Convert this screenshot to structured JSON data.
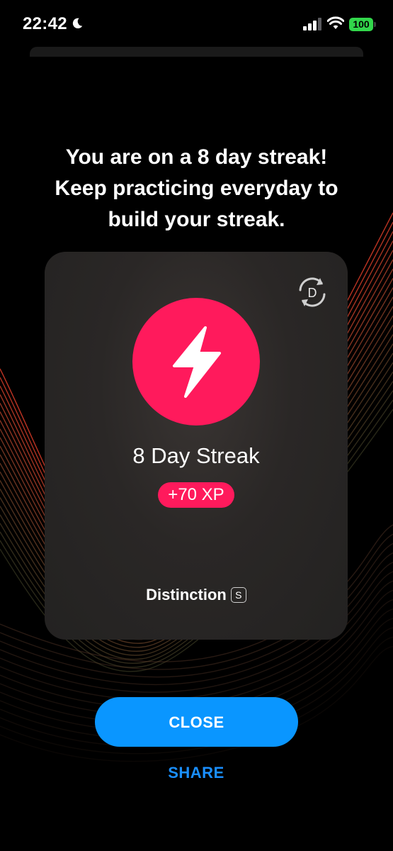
{
  "status_bar": {
    "time": "22:42",
    "battery": "100",
    "icons": [
      "moon-icon",
      "signal-icon",
      "wifi-icon",
      "battery-icon"
    ]
  },
  "headline": {
    "line1": "You are on a 8 day streak!",
    "line2": "Keep practicing everyday to",
    "line3": "build your streak."
  },
  "card": {
    "corner_icon_letter": "D",
    "title": "8 Day Streak",
    "xp": "+70 XP",
    "distinction_label": "Distinction",
    "tier_letter": "S",
    "badge_color": "#ff1a5c"
  },
  "actions": {
    "close_label": "CLOSE",
    "share_label": "SHARE",
    "primary_color": "#0a96ff"
  }
}
